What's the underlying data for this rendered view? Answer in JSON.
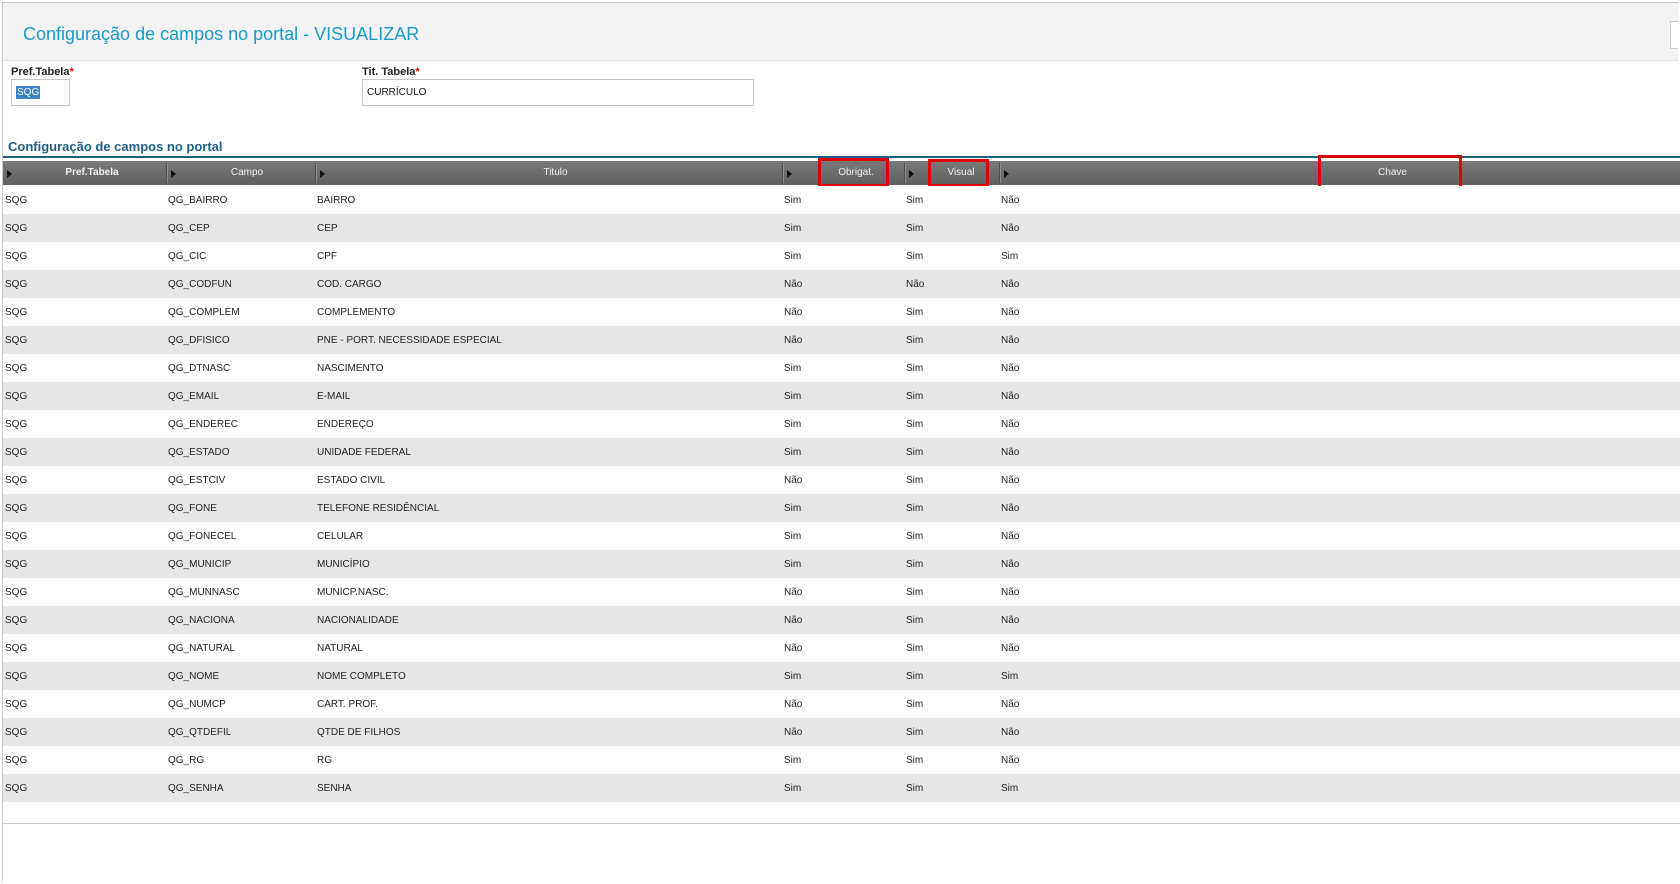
{
  "page": {
    "title": "Configuração de campos no portal - VISUALIZAR"
  },
  "form": {
    "pref_tabela": {
      "label": "Pref.Tabela",
      "required_mark": "*",
      "value": "SQG"
    },
    "tit_tabela": {
      "label": "Tit. Tabela",
      "required_mark": "*",
      "value": "CURRÍCULO"
    }
  },
  "section": {
    "title": "Configuração de campos no portal"
  },
  "grid": {
    "columns": [
      "Pref.Tabela",
      "Campo",
      "Titulo",
      "Obrigat.",
      "Visual",
      "Chave"
    ],
    "highlight_color": "#e00000",
    "rows": [
      [
        "SQG",
        "QG_BAIRRO",
        "BAIRRO",
        "Sim",
        "Sim",
        "Não"
      ],
      [
        "SQG",
        "QG_CEP",
        "CEP",
        "Sim",
        "Sim",
        "Não"
      ],
      [
        "SQG",
        "QG_CIC",
        "CPF",
        "Sim",
        "Sim",
        "Sim"
      ],
      [
        "SQG",
        "QG_CODFUN",
        "COD. CARGO",
        "Não",
        "Não",
        "Não"
      ],
      [
        "SQG",
        "QG_COMPLEM",
        "COMPLEMENTO",
        "Não",
        "Sim",
        "Não"
      ],
      [
        "SQG",
        "QG_DFISICO",
        "PNE - PORT. NECESSIDADE ESPECIAL",
        "Não",
        "Sim",
        "Não"
      ],
      [
        "SQG",
        "QG_DTNASC",
        "NASCIMENTO",
        "Sim",
        "Sim",
        "Não"
      ],
      [
        "SQG",
        "QG_EMAIL",
        "E-MAIL",
        "Sim",
        "Sim",
        "Não"
      ],
      [
        "SQG",
        "QG_ENDEREC",
        "ENDEREÇO",
        "Sim",
        "Sim",
        "Não"
      ],
      [
        "SQG",
        "QG_ESTADO",
        "UNIDADE FEDERAL",
        "Sim",
        "Sim",
        "Não"
      ],
      [
        "SQG",
        "QG_ESTCIV",
        "ESTADO CIVIL",
        "Não",
        "Sim",
        "Não"
      ],
      [
        "SQG",
        "QG_FONE",
        "TELEFONE RESIDÊNCIAL",
        "Sim",
        "Sim",
        "Não"
      ],
      [
        "SQG",
        "QG_FONECEL",
        "CELULAR",
        "Sim",
        "Sim",
        "Não"
      ],
      [
        "SQG",
        "QG_MUNICIP",
        "MUNICÍPIO",
        "Sim",
        "Sim",
        "Não"
      ],
      [
        "SQG",
        "QG_MUNNASC",
        "MUNICP.NASC.",
        "Não",
        "Sim",
        "Não"
      ],
      [
        "SQG",
        "QG_NACIONA",
        "NACIONALIDADE",
        "Não",
        "Sim",
        "Não"
      ],
      [
        "SQG",
        "QG_NATURAL",
        "NATURAL",
        "Não",
        "Sim",
        "Não"
      ],
      [
        "SQG",
        "QG_NOME",
        "NOME COMPLETO",
        "Sim",
        "Sim",
        "Sim"
      ],
      [
        "SQG",
        "QG_NUMCP",
        "CART. PROF.",
        "Não",
        "Sim",
        "Não"
      ],
      [
        "SQG",
        "QG_QTDEFIL",
        "QTDE DE FILHOS",
        "Não",
        "Sim",
        "Não"
      ],
      [
        "SQG",
        "QG_RG",
        "RG",
        "Sim",
        "Sim",
        "Não"
      ],
      [
        "SQG",
        "QG_SENHA",
        "SENHA",
        "Sim",
        "Sim",
        "Sim"
      ]
    ]
  }
}
